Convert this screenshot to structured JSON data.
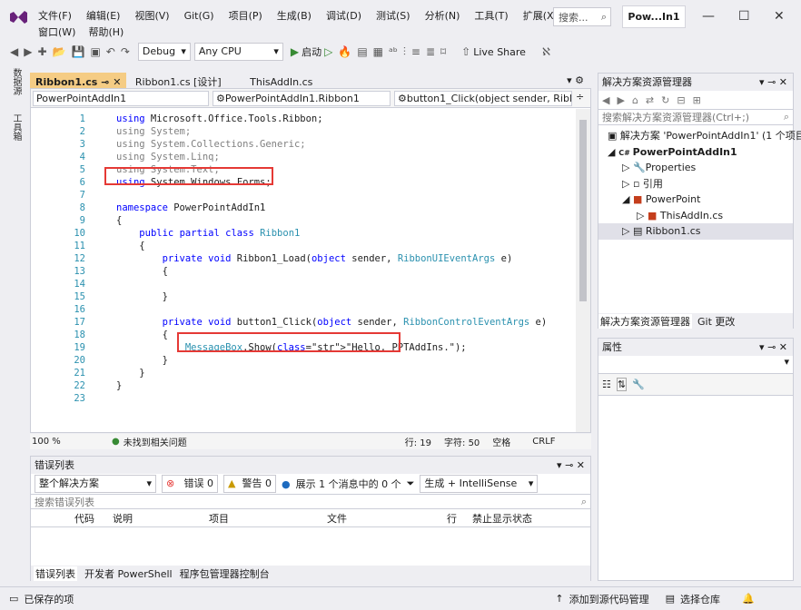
{
  "menu": {
    "row1": [
      "文件(F)",
      "编辑(E)",
      "视图(V)",
      "Git(G)",
      "项目(P)",
      "生成(B)",
      "调试(D)",
      "测试(S)",
      "分析(N)",
      "工具(T)",
      "扩展(X)"
    ],
    "row2": [
      "窗口(W)",
      "帮助(H)"
    ],
    "search_placeholder": "搜索...",
    "title": "Pow...In1"
  },
  "toolbar": {
    "config": "Debug",
    "platform": "Any CPU",
    "start_label": "启动",
    "live_share": "Live Share"
  },
  "sidebar_labels": [
    "数据源",
    "工具箱"
  ],
  "doc_tabs": [
    {
      "label": "Ribbon1.cs",
      "active": true
    },
    {
      "label": "Ribbon1.cs [设计]",
      "active": false
    },
    {
      "label": "ThisAddIn.cs",
      "active": false
    }
  ],
  "nav": {
    "project": "PowerPointAddIn1",
    "class": "PowerPointAddIn1.Ribbon1",
    "member": "button1_Click(object sender, Ribl"
  },
  "code": {
    "lines": [
      {
        "n": "1",
        "t": "using Microsoft.Office.Tools.Ribbon;"
      },
      {
        "n": "2",
        "t": "using System;"
      },
      {
        "n": "3",
        "t": "using System.Collections.Generic;"
      },
      {
        "n": "4",
        "t": "using System.Linq;"
      },
      {
        "n": "5",
        "t": "using System.Text;"
      },
      {
        "n": "6",
        "t": "using System.Windows.Forms;"
      },
      {
        "n": "7",
        "t": ""
      },
      {
        "n": "8",
        "t": "namespace PowerPointAddIn1"
      },
      {
        "n": "9",
        "t": "{"
      },
      {
        "n": "10",
        "t": "    public partial class Ribbon1"
      },
      {
        "n": "11",
        "t": "    {"
      },
      {
        "n": "12",
        "t": "        private void Ribbon1_Load(object sender, RibbonUIEventArgs e)"
      },
      {
        "n": "13",
        "t": "        {"
      },
      {
        "n": "14",
        "t": ""
      },
      {
        "n": "15",
        "t": "        }"
      },
      {
        "n": "16",
        "t": ""
      },
      {
        "n": "17",
        "t": "        private void button1_Click(object sender, RibbonControlEventArgs e)"
      },
      {
        "n": "18",
        "t": "        {"
      },
      {
        "n": "19",
        "t": "            MessageBox.Show(\"Hello, PPTAddIns.\");"
      },
      {
        "n": "20",
        "t": "        }"
      },
      {
        "n": "21",
        "t": "    }"
      },
      {
        "n": "22",
        "t": "}"
      },
      {
        "n": "23",
        "t": ""
      }
    ]
  },
  "editor_status": {
    "zoom": "100 %",
    "issues": "未找到相关问题",
    "line": "行: 19",
    "col": "字符: 50",
    "spaces": "空格",
    "eol": "CRLF"
  },
  "error_list": {
    "title": "错误列表",
    "scope": "整个解决方案",
    "errors": "错误 0",
    "warnings": "警告 0",
    "messages": "展示 1 个消息中的 0 个",
    "build": "生成 + IntelliSense",
    "search_placeholder": "搜索错误列表",
    "columns": [
      "代码",
      "说明",
      "项目",
      "文件",
      "行",
      "禁止显示状态"
    ],
    "bottom_tabs": [
      "错误列表",
      "开发者 PowerShell",
      "程序包管理器控制台"
    ]
  },
  "solution": {
    "title": "解决方案资源管理器",
    "search_placeholder": "搜索解决方案资源管理器(Ctrl+;)",
    "items": [
      {
        "label": "解决方案 'PowerPointAddIn1' (1 个项目",
        "indent": 0
      },
      {
        "label": "PowerPointAddIn1",
        "indent": 1,
        "bold": true
      },
      {
        "label": "Properties",
        "indent": 2
      },
      {
        "label": "引用",
        "indent": 2
      },
      {
        "label": "PowerPoint",
        "indent": 2
      },
      {
        "label": "ThisAddIn.cs",
        "indent": 3
      },
      {
        "label": "Ribbon1.cs",
        "indent": 2,
        "selected": true
      }
    ],
    "tabs": [
      "解决方案资源管理器",
      "Git 更改"
    ]
  },
  "properties": {
    "title": "属性"
  },
  "statusbar": {
    "saved": "已保存的项",
    "add_source": "添加到源代码管理",
    "select_repo": "选择仓库"
  },
  "colors": {
    "accent_tab": "#f5cc84",
    "highlight": "#e53935",
    "vs_purple": "#68217a"
  }
}
